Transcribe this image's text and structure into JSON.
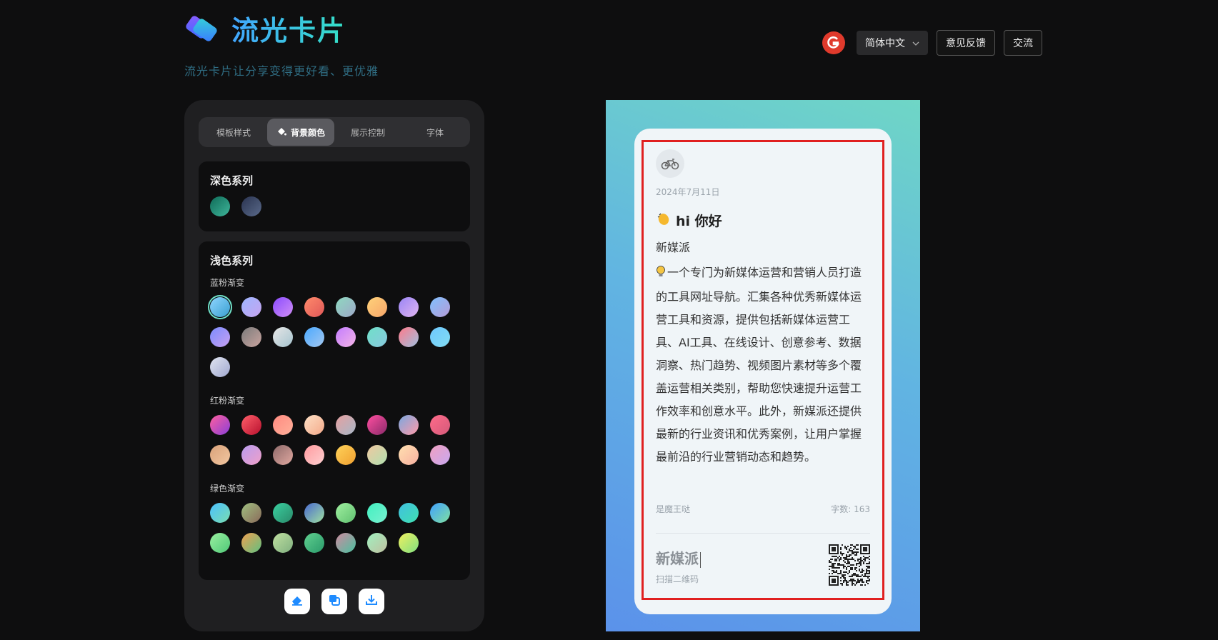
{
  "header": {
    "app_title": "流光卡片",
    "subtitle": "流光卡片让分享变得更好看、更优雅",
    "language": "简体中文",
    "feedback": "意见反馈",
    "community": "交流"
  },
  "tabs": [
    {
      "label": "模板样式"
    },
    {
      "label": "背景颜色"
    },
    {
      "label": "展示控制"
    },
    {
      "label": "字体"
    }
  ],
  "sections": {
    "dark_title": "深色系列",
    "light_title": "浅色系列",
    "groups": [
      "蓝粉渐变",
      "红粉渐变",
      "绿色渐变"
    ]
  },
  "swatch_colors": {
    "dark": [
      [
        "#0f6b58",
        "#3fb59a"
      ],
      [
        "#2a3350",
        "#5a6a8a"
      ]
    ],
    "blue_pink": [
      [
        "#8fd6ff",
        "#3a9fd1"
      ],
      [
        "#9db6ff",
        "#c6a4f0"
      ],
      [
        "#8a4bff",
        "#d08ef5"
      ],
      [
        "#ff8a6b",
        "#e05858"
      ],
      [
        "#8ed9c0",
        "#9ea8c8"
      ],
      [
        "#ffd27a",
        "#f7a66a"
      ],
      [
        "#9a85f5",
        "#e0b4f0"
      ],
      [
        "#7fc0ff",
        "#b69bd6"
      ],
      [
        "#7c8cff",
        "#c6a0f0"
      ],
      [
        "#7b7b7b",
        "#c9a49f"
      ],
      [
        "#e6e6e6",
        "#a6c4cf"
      ],
      [
        "#4aa8ff",
        "#a4c8f0"
      ],
      [
        "#c27cff",
        "#f5b4e6"
      ],
      [
        "#6fe0c8",
        "#89c8de"
      ],
      [
        "#ff7a8a",
        "#a0c0e0"
      ],
      [
        "#6ec8ff",
        "#82dcf2"
      ],
      [
        "#e0e4f0",
        "#a0a8d0"
      ]
    ],
    "red_pink": [
      [
        "#ff5f9e",
        "#8a3fd8"
      ],
      [
        "#ff5f6a",
        "#b8102e"
      ],
      [
        "#ff8a80",
        "#ffb09a"
      ],
      [
        "#fde0c5",
        "#f4a98a"
      ],
      [
        "#e6a0a0",
        "#a7b8c8"
      ],
      [
        "#ff4fa0",
        "#8a2a6a"
      ],
      [
        "#7aa8e0",
        "#ff9aa8"
      ],
      [
        "#ff6b8a",
        "#d45a7a"
      ],
      [
        "#d9a27a",
        "#f2c6a0"
      ],
      [
        "#b89cf0",
        "#f0a0c8"
      ],
      [
        "#8e6a6a",
        "#e0a8a0"
      ],
      [
        "#ff9a9e",
        "#fecfd0"
      ],
      [
        "#ffd25a",
        "#f0a030"
      ],
      [
        "#f0c8a0",
        "#b0e0b0"
      ],
      [
        "#ffe0b0",
        "#f7b0a0"
      ],
      [
        "#f0a0c0",
        "#c8a8f0"
      ]
    ],
    "green": [
      [
        "#4ac0ff",
        "#7adcb0"
      ],
      [
        "#a0c080",
        "#8a6a5a"
      ],
      [
        "#3ad0a0",
        "#2a8a6a"
      ],
      [
        "#4a6ad0",
        "#a0e0a0"
      ],
      [
        "#a0f0a0",
        "#60c070"
      ],
      [
        "#40f0c0",
        "#7af0d0"
      ],
      [
        "#40c0e0",
        "#40e0b0"
      ],
      [
        "#40a0ff",
        "#80e0a0"
      ],
      [
        "#9af0a0",
        "#50c878"
      ],
      [
        "#f0a050",
        "#60c080"
      ],
      [
        "#c0e0a0",
        "#80b080"
      ],
      [
        "#60d090",
        "#2a9a6a"
      ],
      [
        "#d08aa0",
        "#4ac0a0"
      ],
      [
        "#a0f0c0",
        "#c0c0a0"
      ],
      [
        "#f0f060",
        "#80e080"
      ]
    ]
  },
  "card": {
    "date": "2024年7月11日",
    "greeting": "hi 你好",
    "name": "新媒派",
    "body": "一个专门为新媒体运营和营销人员打造的工具网址导航。汇集各种优秀新媒体运营工具和资源，提供包括新媒体运营工具、AI工具、在线设计、创意参考、数据洞察、热门趋势、视频图片素材等多个覆盖运营相关类别，帮助您快速提升运营工作效率和创意水平。此外，新媒派还提供最新的行业资讯和优秀案例，让用户掌握最前沿的行业营销动态和趋势。",
    "author": "是魔王哒",
    "wordcount": "字数: 163",
    "qr_title": "新媒派",
    "qr_hint": "扫描二维码"
  }
}
